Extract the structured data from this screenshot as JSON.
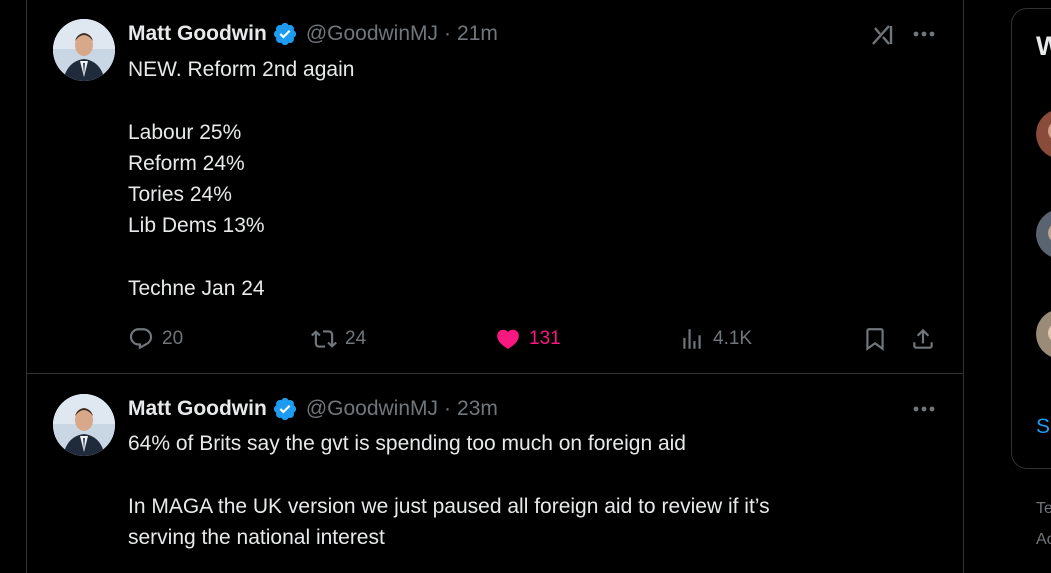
{
  "colors": {
    "background": "#000000",
    "text_primary": "#e7e9ea",
    "text_secondary": "#71767b",
    "verified": "#1d9bf0",
    "like_active": "#f91880",
    "border": "#2f3336"
  },
  "tweets": [
    {
      "author_name": "Matt Goodwin",
      "handle": "@GoodwinMJ",
      "separator": "·",
      "time": "21m",
      "lines": [
        "NEW. Reform 2nd again",
        "",
        "Labour 25%",
        "Reform 24%",
        "Tories 24%",
        "Lib Dems 13%",
        "",
        "Techne Jan 24"
      ],
      "replies": "20",
      "reposts": "24",
      "likes": "131",
      "views": "4.1K",
      "liked": true
    },
    {
      "author_name": "Matt Goodwin",
      "handle": "@GoodwinMJ",
      "separator": "·",
      "time": "23m",
      "lines": [
        "64% of Brits say the gvt is spending too much on foreign aid",
        "",
        "In MAGA the UK version we just paused all foreign aid to review if it’s",
        "serving the national interest"
      ]
    }
  ],
  "sidebar": {
    "heading": "W",
    "link": "S",
    "footer_line_1": "Te",
    "footer_line_2": "Ac"
  },
  "icons": {
    "verified": "verified-badge-icon",
    "more": "more-icon",
    "grok": "grok-icon",
    "reply": "reply-icon",
    "repost": "repost-icon",
    "like": "heart-icon",
    "views": "views-icon",
    "bookmark": "bookmark-icon",
    "share": "share-icon"
  }
}
